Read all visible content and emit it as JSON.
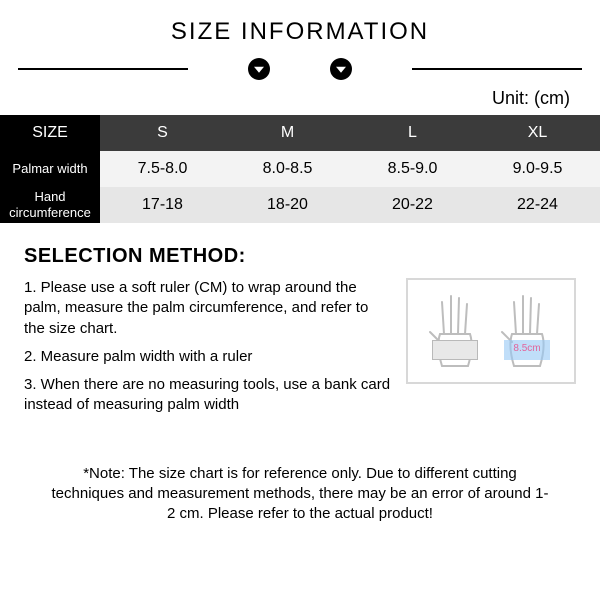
{
  "heading": "SIZE INFORMATION",
  "unit_label": "Unit: (cm)",
  "chart_data": {
    "type": "table",
    "columns": [
      "SIZE",
      "S",
      "M",
      "L",
      "XL"
    ],
    "rows": [
      {
        "label": "Palmar width",
        "values": [
          "7.5-8.0",
          "8.0-8.5",
          "8.5-9.0",
          "9.0-9.5"
        ]
      },
      {
        "label": "Hand circumference",
        "values": [
          "17-18",
          "18-20",
          "20-22",
          "22-24"
        ]
      }
    ]
  },
  "method": {
    "title": "SELECTION METHOD:",
    "steps": [
      "1. Please use a soft ruler (CM) to wrap around the palm, measure the palm circumference, and refer to the size chart.",
      "2. Measure palm width with a ruler",
      "3. When there are no measuring tools, use a bank card instead of measuring palm width"
    ],
    "illustration_measure": "8.5cm"
  },
  "note": "*Note: The size chart is for reference only. Due to different cutting techniques and measurement methods, there may be an error of around 1-2 cm. Please refer to the actual product!"
}
